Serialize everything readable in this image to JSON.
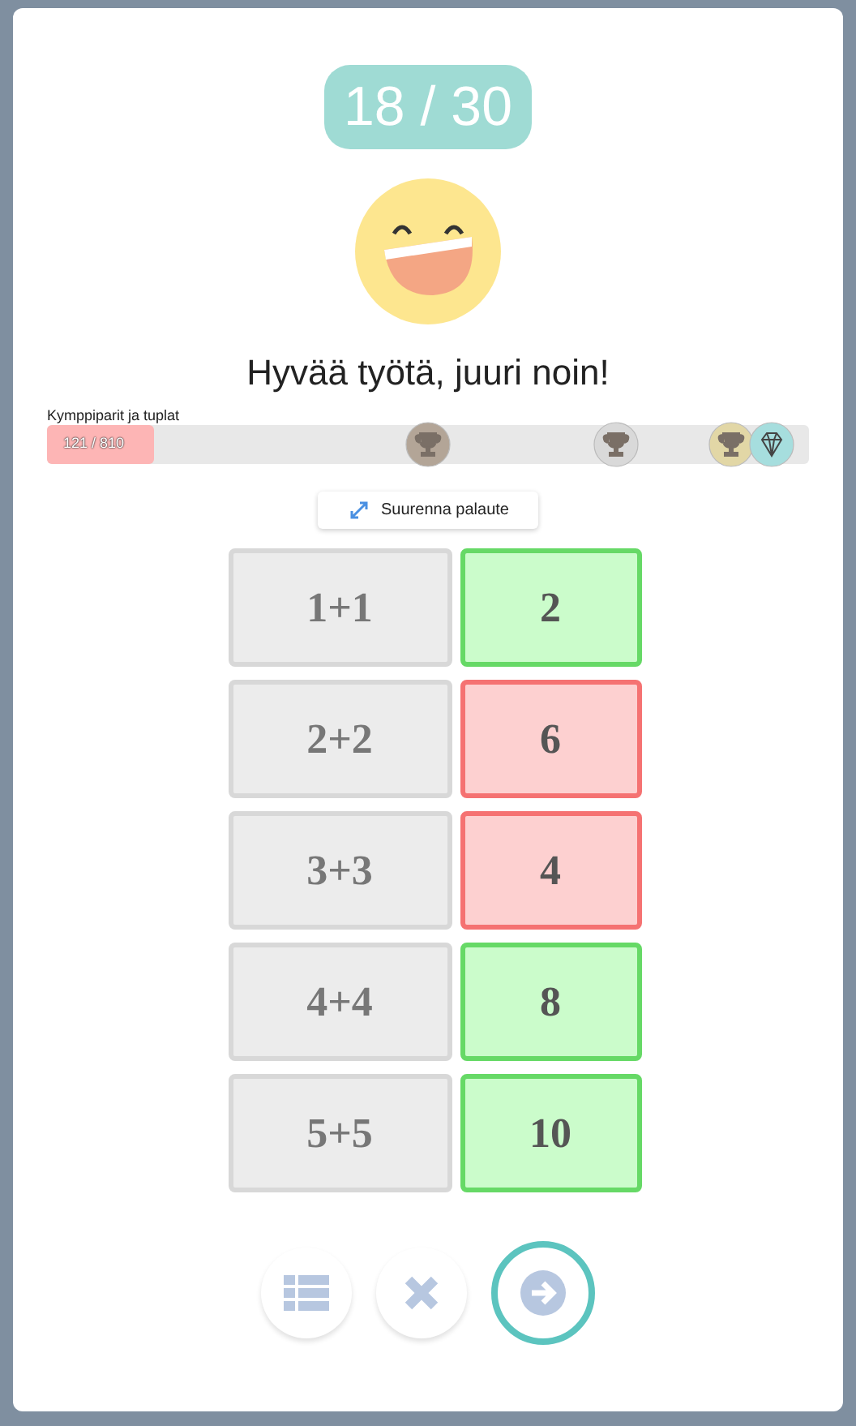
{
  "score": "18 / 30",
  "message": "Hyvää työtä, juuri noin!",
  "progress": {
    "label": "Kymppiparit ja tuplat",
    "reading": "121 / 810",
    "level": 0.14,
    "badges": [
      {
        "kind": "bronze"
      },
      {
        "kind": "silver"
      },
      {
        "kind": "gold"
      },
      {
        "kind": "diamond"
      }
    ]
  },
  "expand_button": "Suurenna palaute",
  "answers": [
    {
      "question": "1+1",
      "answer": "2",
      "correct": true
    },
    {
      "question": "2+2",
      "answer": "6",
      "correct": false
    },
    {
      "question": "3+3",
      "answer": "4",
      "correct": false
    },
    {
      "question": "4+4",
      "answer": "8",
      "correct": true
    },
    {
      "question": "5+5",
      "answer": "10",
      "correct": true
    }
  ]
}
